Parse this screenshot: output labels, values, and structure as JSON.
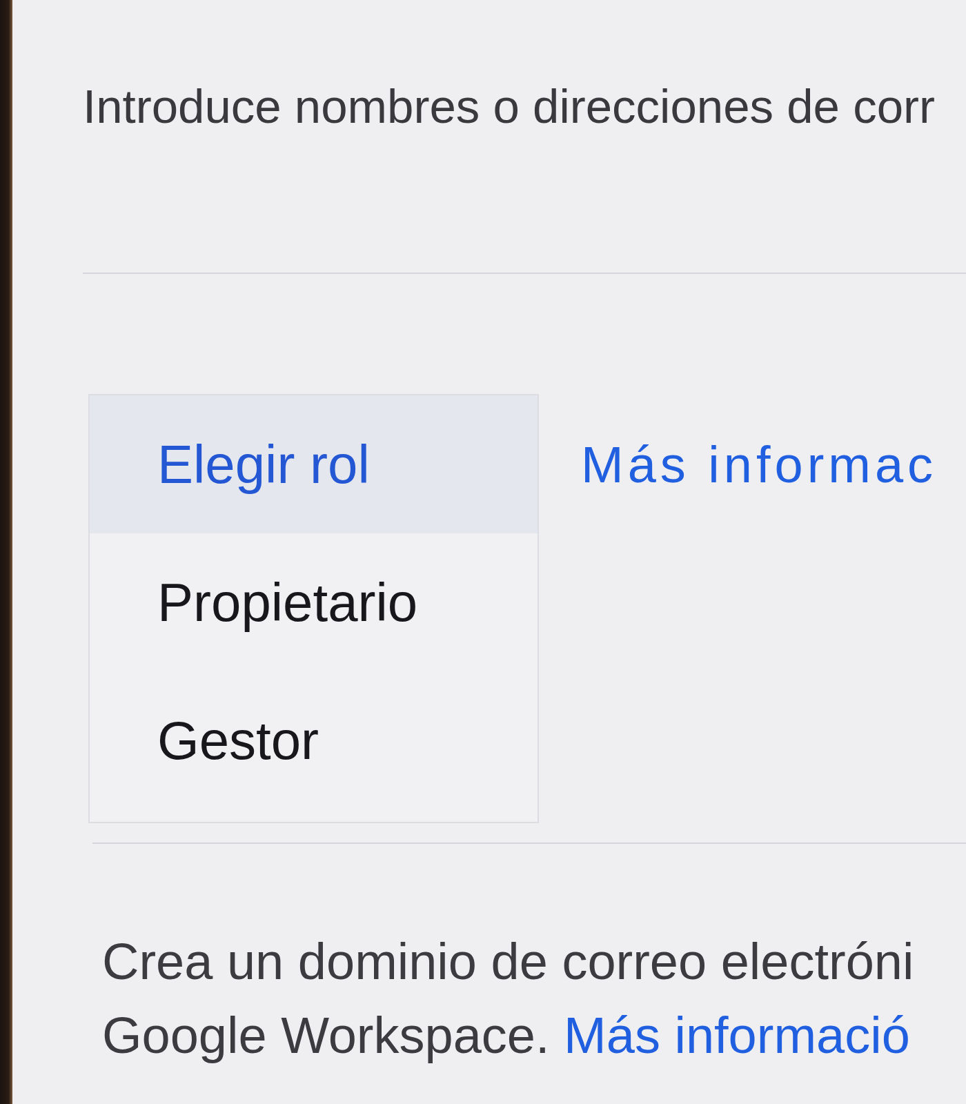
{
  "prompt": "Introduce nombres o direcciones de corr",
  "role_menu": {
    "items": [
      {
        "label": "Elegir rol",
        "selected": true
      },
      {
        "label": "Propietario",
        "selected": false
      },
      {
        "label": "Gestor",
        "selected": false
      }
    ]
  },
  "more_info_link": "Más informac",
  "domain_note": {
    "lines": [
      "Crea un dominio de correo electróni",
      "Google Workspace."
    ],
    "link": "Más informació"
  }
}
